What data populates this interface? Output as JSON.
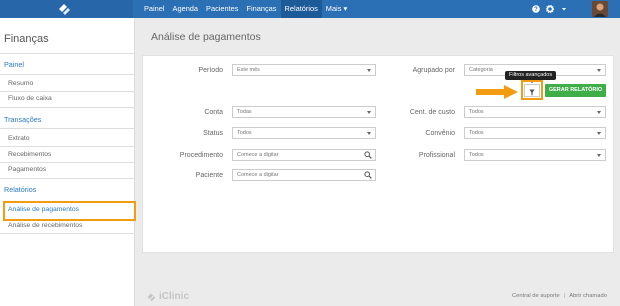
{
  "nav": {
    "items": [
      {
        "label": "Painel"
      },
      {
        "label": "Agenda"
      },
      {
        "label": "Pacientes"
      },
      {
        "label": "Finanças"
      },
      {
        "label": "Relatórios"
      },
      {
        "label": "Mais ▾"
      }
    ]
  },
  "colors": {
    "topbar": "#2b6fb5",
    "accent": "#2b79c2",
    "highlight": "#f39c12",
    "generate_button": "#3fae49"
  },
  "sidebar": {
    "title": "Finanças",
    "sections": [
      {
        "label": "Painel",
        "items": [
          "Resumo",
          "Fluxo de caixa"
        ]
      },
      {
        "label": "Transações",
        "items": [
          "Extrato",
          "Recebimentos",
          "Pagamentos"
        ]
      },
      {
        "label": "Relatórios",
        "items": [
          "Análise de pagamentos",
          "Análise de recebimentos"
        ]
      }
    ]
  },
  "main": {
    "title": "Análise de pagamentos",
    "fields": {
      "periodo": {
        "label": "Período",
        "value": "Este mês"
      },
      "agrupado": {
        "label": "Agrupado por",
        "value": "Categoria"
      },
      "conta": {
        "label": "Conta",
        "value": "Todas"
      },
      "centro": {
        "label": "Cent. de custo",
        "value": "Todos"
      },
      "status": {
        "label": "Status",
        "value": "Todos"
      },
      "convenio": {
        "label": "Convênio",
        "value": "Todos"
      },
      "procedimento": {
        "label": "Procedimento",
        "placeholder": "Comece a digitar"
      },
      "profissional": {
        "label": "Profissional",
        "value": "Todos"
      },
      "paciente": {
        "label": "Paciente",
        "placeholder": "Comece a digitar"
      }
    },
    "tooltip": "Filtros avançados",
    "generate_label": "GERAR RELATÓRIO"
  },
  "footer": {
    "brand": "iClinic",
    "links": [
      "Central de suporte",
      "Abrir chamado"
    ]
  }
}
